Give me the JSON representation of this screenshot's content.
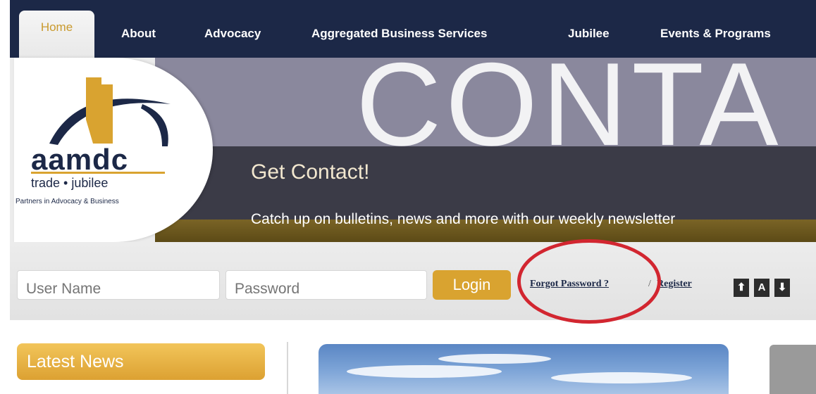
{
  "nav": {
    "items": [
      {
        "label": "Home",
        "active": true
      },
      {
        "label": "About"
      },
      {
        "label": "Advocacy"
      },
      {
        "label": "Aggregated Business Services"
      },
      {
        "label": "Jubilee"
      },
      {
        "label": "Events & Programs"
      }
    ]
  },
  "logo": {
    "main": "aamdc",
    "sub": "trade • jubilee",
    "tagline": "Partners in Advocacy & Business"
  },
  "banner": {
    "big_text": "CONTA",
    "title": "Get Contact!",
    "subtitle": "Catch up on bulletins, news and more with our weekly newsletter"
  },
  "login": {
    "username_placeholder": "User Name",
    "password_placeholder": "Password",
    "button_label": "Login",
    "forgot_label": "Forgot Password ?",
    "separator": "/",
    "register_label": "Register",
    "text_size": {
      "increase": "⬆",
      "reset": "A",
      "decrease": "⬇"
    }
  },
  "news": {
    "header": "Latest News"
  },
  "colors": {
    "nav_bg": "#1c2847",
    "accent_gold": "#d9a330",
    "annotation_red": "#d22630"
  }
}
